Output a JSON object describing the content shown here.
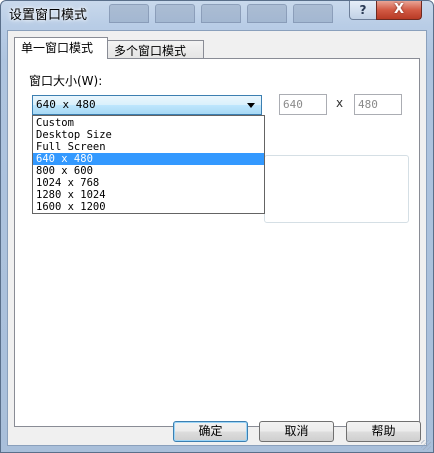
{
  "window": {
    "title": "设置窗口模式",
    "help_glyph": "?",
    "close_glyph": "X"
  },
  "tabs": [
    {
      "label": "单一窗口模式",
      "active": true
    },
    {
      "label": "多个窗口模式",
      "active": false
    }
  ],
  "window_size": {
    "label": "窗口大小(W):",
    "selected": "640 x 480",
    "width": "640",
    "height": "480",
    "separator": "x",
    "options": [
      {
        "label": "Custom",
        "selected": false
      },
      {
        "label": "Desktop Size",
        "selected": false
      },
      {
        "label": "Full Screen",
        "selected": false
      },
      {
        "label": "640 x 480",
        "selected": true
      },
      {
        "label": "800 x 600",
        "selected": false
      },
      {
        "label": "1024 x 768",
        "selected": false
      },
      {
        "label": "1280 x 1024",
        "selected": false
      },
      {
        "label": "1600 x 1200",
        "selected": false
      }
    ]
  },
  "buttons": {
    "ok": "确定",
    "cancel": "取消",
    "help": "帮助"
  },
  "colors": {
    "selection": "#3399ff",
    "close_button": "#c8452f",
    "titlebar": "#b9cde6"
  }
}
